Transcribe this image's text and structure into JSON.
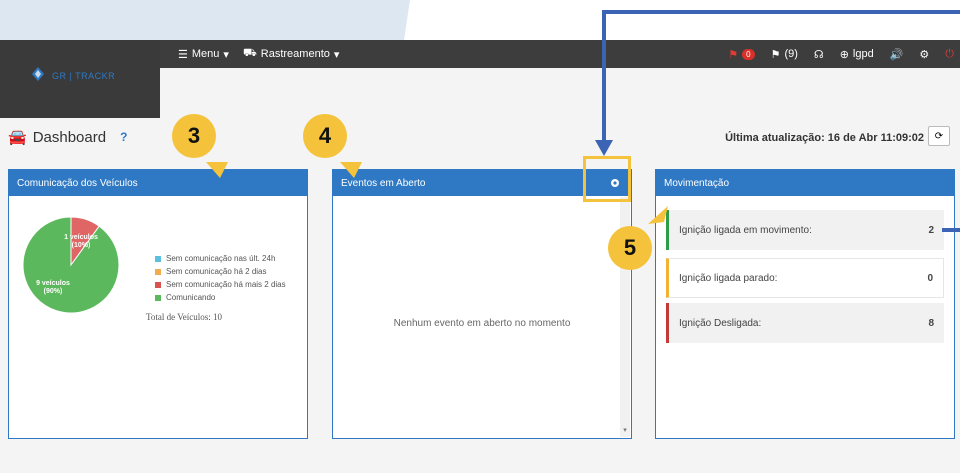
{
  "nav": {
    "menu_label": "Menu",
    "tracking_label": "Rastreamento",
    "alert_badge": "0",
    "flag_count": "(9)",
    "lgpd_label": "lgpd",
    "logo_text": "GR | TRACKR"
  },
  "header": {
    "title": "Dashboard",
    "help": "?",
    "last_update": "Última atualização: 16 de Abr 11:09:02"
  },
  "panels": {
    "communication": {
      "title": "Comunicação dos Veículos",
      "slices": [
        {
          "label": "1 veículos",
          "percent": "(10%)",
          "value": 1,
          "color": "#e06666"
        },
        {
          "label": "9 veículos",
          "percent": "(90%)",
          "value": 9,
          "color": "#5cb85c"
        }
      ],
      "legend": [
        {
          "label": "Sem comunicação nas últ. 24h",
          "color": "#5bc0de"
        },
        {
          "label": "Sem comunicação há 2 dias",
          "color": "#f0ad4e"
        },
        {
          "label": "Sem comunicação há mais 2 dias",
          "color": "#d9534f"
        },
        {
          "label": "Comunicando",
          "color": "#5cb85c"
        }
      ],
      "total": "Total de Veículos: 10"
    },
    "events": {
      "title": "Eventos em Aberto",
      "empty": "Nenhum evento em aberto no momento"
    },
    "movement": {
      "title": "Movimentação",
      "rows": [
        {
          "label": "Ignição ligada em movimento:",
          "value": "2"
        },
        {
          "label": "Ignição ligada parado:",
          "value": "0"
        },
        {
          "label": "Ignição Desligada:",
          "value": "8"
        }
      ]
    }
  },
  "callouts": [
    "3",
    "4",
    "5"
  ]
}
